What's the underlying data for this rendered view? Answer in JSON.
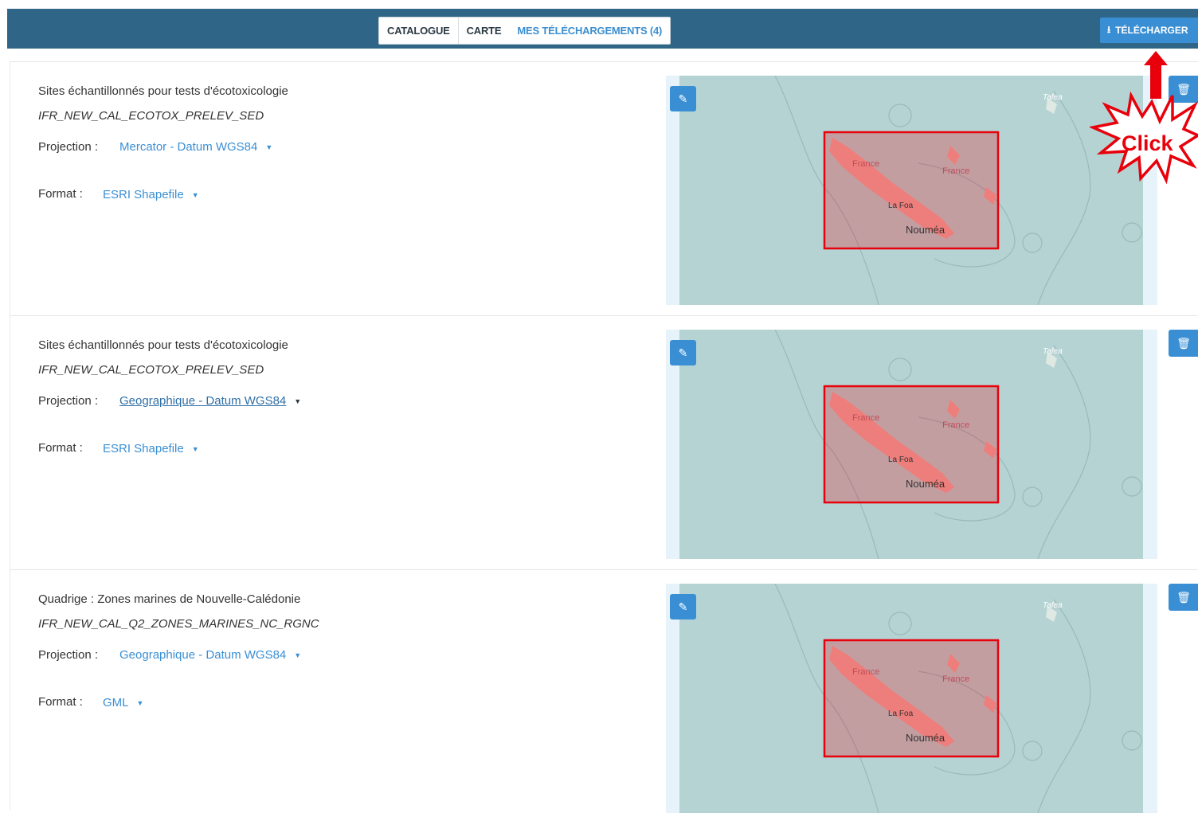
{
  "tabs": [
    {
      "label": "CATALOGUE"
    },
    {
      "label": "CARTE"
    },
    {
      "label": "MES TÉLÉCHARGEMENTS (4)"
    }
  ],
  "download_button": {
    "label": "TÉLÉCHARGER",
    "icon": "download-icon"
  },
  "annotation": {
    "label": "Click",
    "color": "#e8000b"
  },
  "projection_label": "Projection :",
  "format_label": "Format :",
  "items": [
    {
      "title": "Sites échantillonnés pour tests d'écotoxicologie",
      "code": "IFR_NEW_CAL_ECOTOX_PRELEV_SED",
      "projection": "Mercator - Datum WGS84",
      "format": "ESRI Shapefile"
    },
    {
      "title": "Sites échantillonnés pour tests d'écotoxicologie",
      "code": "IFR_NEW_CAL_ECOTOX_PRELEV_SED",
      "projection": "Geographique - Datum WGS84",
      "format": "ESRI Shapefile"
    },
    {
      "title": "Quadrige : Zones marines de Nouvelle-Calédonie",
      "code": "IFR_NEW_CAL_Q2_ZONES_MARINES_NC_RGNC",
      "projection": "Geographique - Datum WGS84",
      "format": "GML"
    }
  ],
  "map_labels": {
    "france": "France",
    "lafoa": "La Foa",
    "noumea": "Nouméa",
    "tafea": "Tafea"
  },
  "colors": {
    "header": "#2f6586",
    "accent": "#3a8fd4",
    "map_water": "#b6d3d3",
    "selection": "#e8000b"
  }
}
